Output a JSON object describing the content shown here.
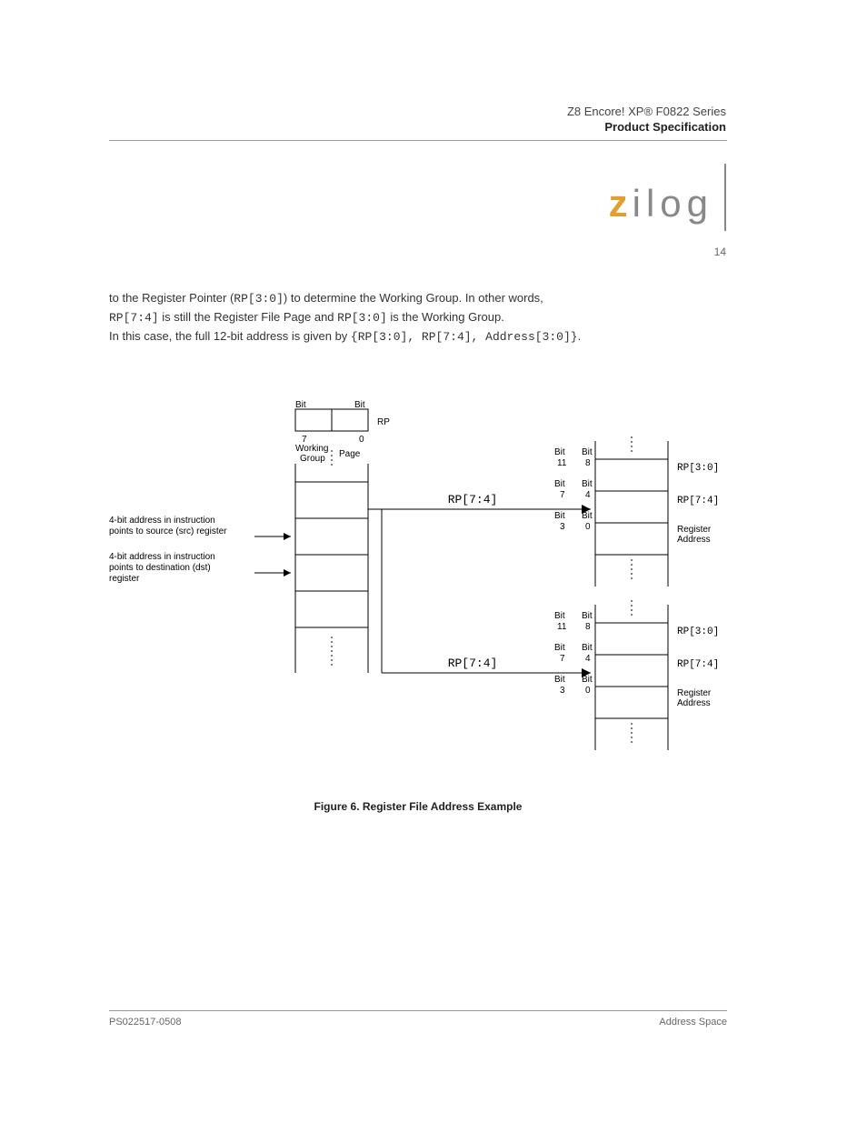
{
  "header": {
    "doc_title": "Z8 Encore! XP® F0822 Series",
    "subtitle": "Product Specification"
  },
  "logo": {
    "accent": "z",
    "rest": "ilog"
  },
  "page_num": "14",
  "para1_a": "to the Register Pointer (",
  "para1_b": ") to determine the Working Group. In other words,",
  "para1_c": " is still the Register File Page and ",
  "para1_d": " is the Working Group.",
  "rp30": "RP[3:0]",
  "rp74": "RP[7:4]",
  "para2_a": "In this case, the full 12-bit address is given by ",
  "addr_expr": "{RP[3:0], RP[7:4], Address[3:0]}",
  "para2_b": ".",
  "figure": {
    "bit7": "Bit",
    "bit7n": "7",
    "bit0": "Bit",
    "bit0n": "0",
    "rp_label": "RP",
    "wg_label": "Working\nGroup",
    "page_label": "Page",
    "src": "4-bit address in instruction\npoints to source (src) register",
    "dst": "4-bit address in instruction\npoints to destination (dst)\nregister",
    "rp74_1": "RP[7:4]",
    "rp74_2": "RP[7:4]",
    "rp30_1": "RP[3:0]",
    "rp30_2": "RP[3:0]",
    "bit11a": "Bit",
    "bit11an": "11",
    "bit8a": "Bit",
    "bit8an": "8",
    "bit7b": "Bit",
    "bit7bn": "7",
    "bit4b": "Bit",
    "bit4bn": "4",
    "bit3b": "Bit",
    "bit3bn": "3",
    "bit0b": "Bit",
    "bit0bn": "0",
    "reg_addr_right": "Register\nAddress",
    "bit11c": "Bit",
    "bit11cn": "11",
    "bit8c": "Bit",
    "bit8cn": "8",
    "bit7d": "Bit",
    "bit7dn": "7",
    "bit4d": "Bit",
    "bit4dn": "4",
    "bit3d": "Bit",
    "bit3dn": "3",
    "bit0d": "Bit",
    "bit0dn": "0",
    "reg_addr_right2": "Register\nAddress"
  },
  "fig_caption": "Figure 6. Register File Address Example",
  "footer": {
    "left": "PS022517-0508",
    "right": "Address Space"
  }
}
